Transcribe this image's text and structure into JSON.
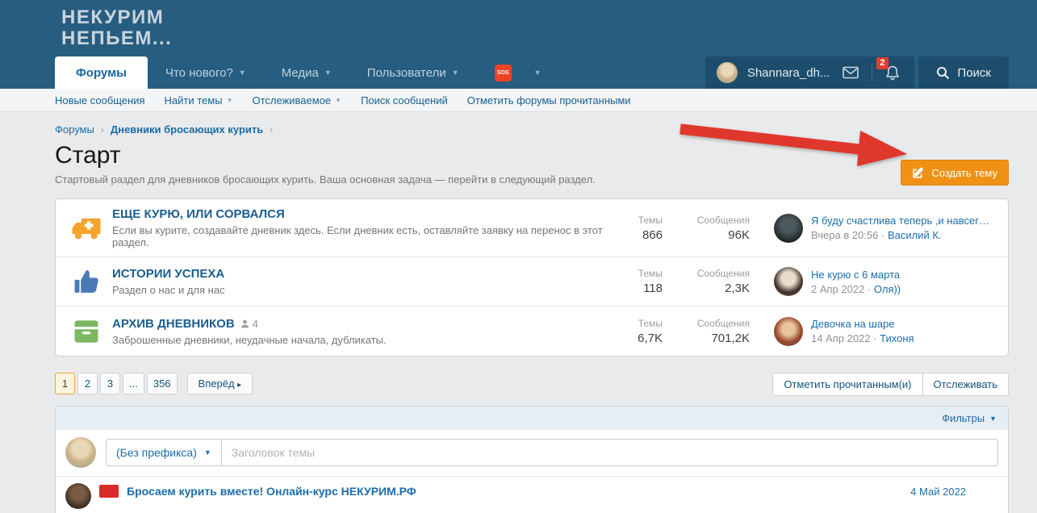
{
  "header": {
    "logo_line1": "НЕКУРИМ",
    "logo_line2": "НЕПЬЕМ...",
    "tabs": [
      {
        "label": "Форумы",
        "active": true
      },
      {
        "label": "Что нового?",
        "has_menu": true
      },
      {
        "label": "Медиа",
        "has_menu": true
      },
      {
        "label": "Пользователи",
        "has_menu": true
      }
    ],
    "sos_label": "SOS",
    "user_name": "Shannara_dh...",
    "notification_count": "2",
    "search_label": "Поиск"
  },
  "subnav": {
    "items": [
      {
        "label": "Новые сообщения",
        "has_menu": false
      },
      {
        "label": "Найти темы",
        "has_menu": true
      },
      {
        "label": "Отслеживаемое",
        "has_menu": true
      },
      {
        "label": "Поиск сообщений",
        "has_menu": false
      },
      {
        "label": "Отметить форумы прочитанными",
        "has_menu": false
      }
    ]
  },
  "breadcrumb": {
    "crumb1": "Форумы",
    "crumb2": "Дневники бросающих курить"
  },
  "page": {
    "title": "Старт",
    "description": "Стартовый раздел для дневников бросающих курить. Ваша основная задача — перейти в следующий раздел."
  },
  "create_button": {
    "label": "Создать тему",
    "icon": "compose-pencil-icon",
    "color": "#f09116"
  },
  "annotation": {
    "arrow_color": "#e0372c"
  },
  "forums": {
    "topics_label": "Темы",
    "messages_label": "Сообщения",
    "rows": [
      {
        "icon": "ambulance-icon",
        "icon_color": "#f5a32a",
        "title": "ЕЩЕ КУРЮ, ИЛИ СОРВАЛСЯ",
        "description": "Если вы курите, создавайте дневник здесь. Если дневник есть, оставляйте заявку на перенос в этот раздел.",
        "topics": "866",
        "messages": "96K",
        "latest_title": "Я буду счастлива теперь ,и навсег…",
        "latest_date": "Вчера в 20:56 ·",
        "latest_user": "Василий К."
      },
      {
        "icon": "thumbs-up-icon",
        "icon_color": "#4a7ab5",
        "title": "ИСТОРИИ УСПЕХА",
        "description": "Раздел о нас и для нас",
        "topics": "118",
        "messages": "2,3K",
        "latest_title": "Не курю с 6 марта",
        "latest_date": "2 Апр 2022 ·",
        "latest_user": "Оля))"
      },
      {
        "icon": "archive-box-icon",
        "icon_color": "#7cb761",
        "title": "АРХИВ ДНЕВНИКОВ",
        "subforum_count": "4",
        "description": "Заброшенные дневники, неудачные начала, дубликаты.",
        "topics": "6,7K",
        "messages": "701,2K",
        "latest_title": "Девочка на шаре",
        "latest_date": "14 Апр 2022 ·",
        "latest_user": "Тихоня"
      }
    ]
  },
  "pagination": {
    "pages": [
      "1",
      "2",
      "3",
      "...",
      "356"
    ],
    "current": "1",
    "next_label": "Вперёд"
  },
  "actions": {
    "mark_read": "Отметить прочитанным(и)",
    "watch": "Отслеживать"
  },
  "filters": {
    "label": "Фильтры"
  },
  "composer": {
    "prefix": "(Без префикса)",
    "placeholder": "Заголовок темы"
  },
  "partial_row": {
    "title": "Бросаем курить вместе! Онлайн-курс НЕКУРИМ.РФ",
    "date": "4 Май 2022"
  }
}
